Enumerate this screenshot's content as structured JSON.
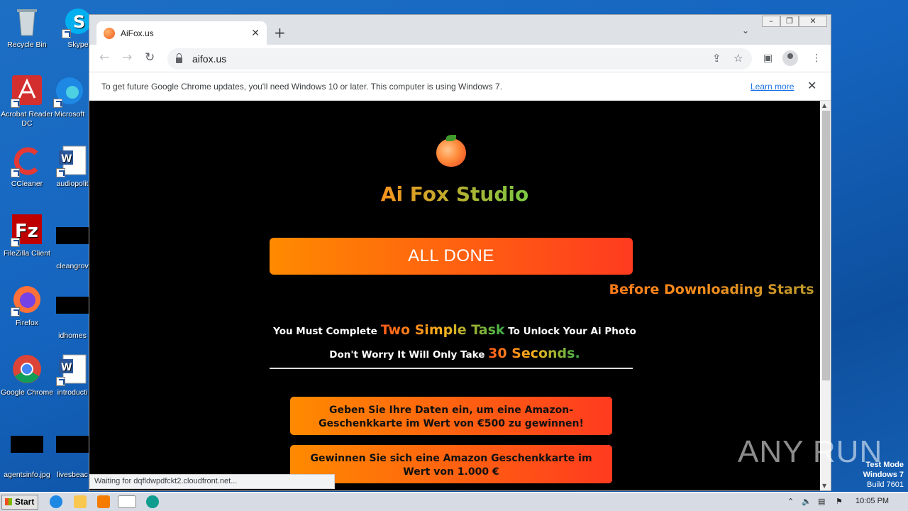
{
  "desktop": {
    "icons": [
      {
        "label": "Recycle Bin",
        "icon": "recycle-bin-icon"
      },
      {
        "label": "Skype",
        "icon": "skype-icon"
      },
      {
        "label": "Acrobat Reader DC",
        "icon": "acrobat-icon"
      },
      {
        "label": "Microsoft",
        "icon": "edge-icon"
      },
      {
        "label": "CCleaner",
        "icon": "ccleaner-icon"
      },
      {
        "label": "audiopolit",
        "icon": "word-doc-icon"
      },
      {
        "label": "FileZilla Client",
        "icon": "filezilla-icon"
      },
      {
        "label": "cleangrov",
        "icon": "black-file-icon"
      },
      {
        "label": "Firefox",
        "icon": "firefox-icon"
      },
      {
        "label": "idhomes",
        "icon": "black-file-icon"
      },
      {
        "label": "Google Chrome",
        "icon": "chrome-icon"
      },
      {
        "label": "introducti",
        "icon": "word-doc-icon"
      },
      {
        "label": "agentsinfo.jpg",
        "icon": "black-file-icon"
      },
      {
        "label": "livesbeac",
        "icon": "black-file-icon"
      }
    ]
  },
  "browser": {
    "tab_title": "AiFox.us",
    "tab_close": "✕",
    "new_tab": "+",
    "tab_list": "⌄",
    "url": "aifox.us",
    "infobar_message": "To get future Google Chrome updates, you'll need Windows 10 or later. This computer is using Windows 7.",
    "infobar_link": "Learn more",
    "infobar_close": "✕",
    "status_text": "Waiting for dqfldwpdfckt2.cloudfront.net..."
  },
  "page": {
    "site_title": "Ai Fox Studio",
    "cta_button": "ALL DONE",
    "subtitle": "Before Downloading Starts",
    "line1_pre": "You Must Complete ",
    "line1_highlight": "Two Simple Task",
    "line1_post": " To Unlock Your Ai Photo",
    "line2_pre": "Don't Worry It Will Only Take ",
    "line2_highlight": "30 Seconds.",
    "offers": [
      "Geben Sie Ihre Daten ein, um eine Amazon-Geschenkkarte im Wert von €500 zu gewinnen!",
      "Gewinnen Sie sich eine Amazon Geschenkkarte im Wert von 1.000 €"
    ]
  },
  "taskbar": {
    "start_label": "Start",
    "clock": "10:05 PM"
  },
  "overlay": {
    "watermark": "ANY RUN",
    "test_mode": "Test Mode",
    "os_name": "Windows 7",
    "build": "Build 7601"
  },
  "colors": {
    "accent_orange": "#ff8a00",
    "accent_red": "#ff3b1f",
    "accent_green": "#3bb34a",
    "link_blue": "#1a73e8"
  }
}
